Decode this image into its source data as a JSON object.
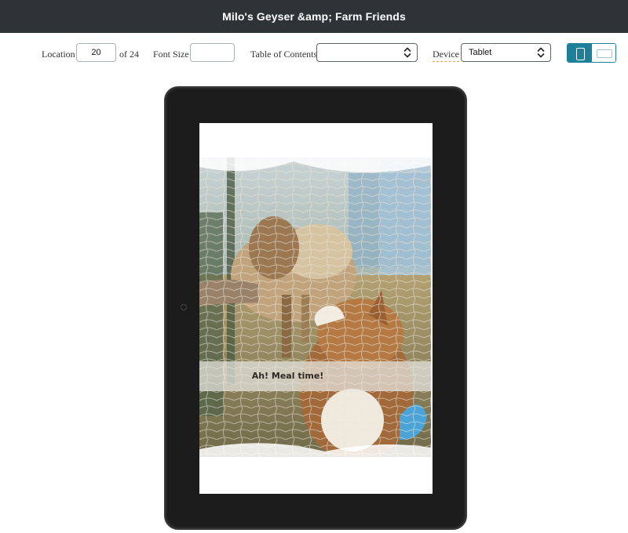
{
  "app": {
    "title": "Milo's Geyser &amp; Farm Friends"
  },
  "toolbar": {
    "location_label": "Location",
    "location_value": "20",
    "location_total": "of 24",
    "font_size_label": "Font Size",
    "font_size_value": "",
    "toc_label": "Table of Contents",
    "toc_value": "",
    "device_label": "Device",
    "device_value": "Tablet",
    "orientation": {
      "selected": "portrait",
      "options": [
        "portrait",
        "landscape"
      ]
    }
  },
  "page": {
    "caption": "Ah! Meal time!"
  },
  "colors": {
    "title_bar": "#2e3436",
    "accent": "#1e7f98",
    "tablet_body": "#1c1c1c",
    "device_label_underline": "#e8a34a"
  },
  "icons": {
    "select_chevron": "chevron-up-down-icon",
    "portrait": "portrait-orientation-icon",
    "landscape": "landscape-orientation-icon",
    "camera": "camera-dot-icon"
  }
}
